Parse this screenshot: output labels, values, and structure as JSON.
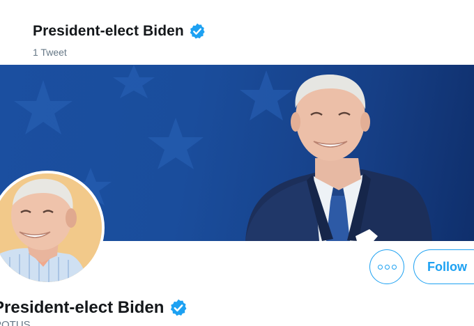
{
  "header": {
    "name": "President-elect Biden",
    "tweet_count": "1 Tweet",
    "verified_icon": "verified-badge-icon"
  },
  "banner": {
    "background_color": "#1b4fa0",
    "subject": "portrait-photo"
  },
  "profile": {
    "name": "President-elect Biden",
    "handle": "POTUS",
    "avatar_background": "#f2c98a"
  },
  "actions": {
    "more_icon": "more-options-icon",
    "follow_label": "Follow"
  },
  "colors": {
    "accent": "#1da1f2",
    "text_primary": "#14171a",
    "text_secondary": "#657786"
  }
}
